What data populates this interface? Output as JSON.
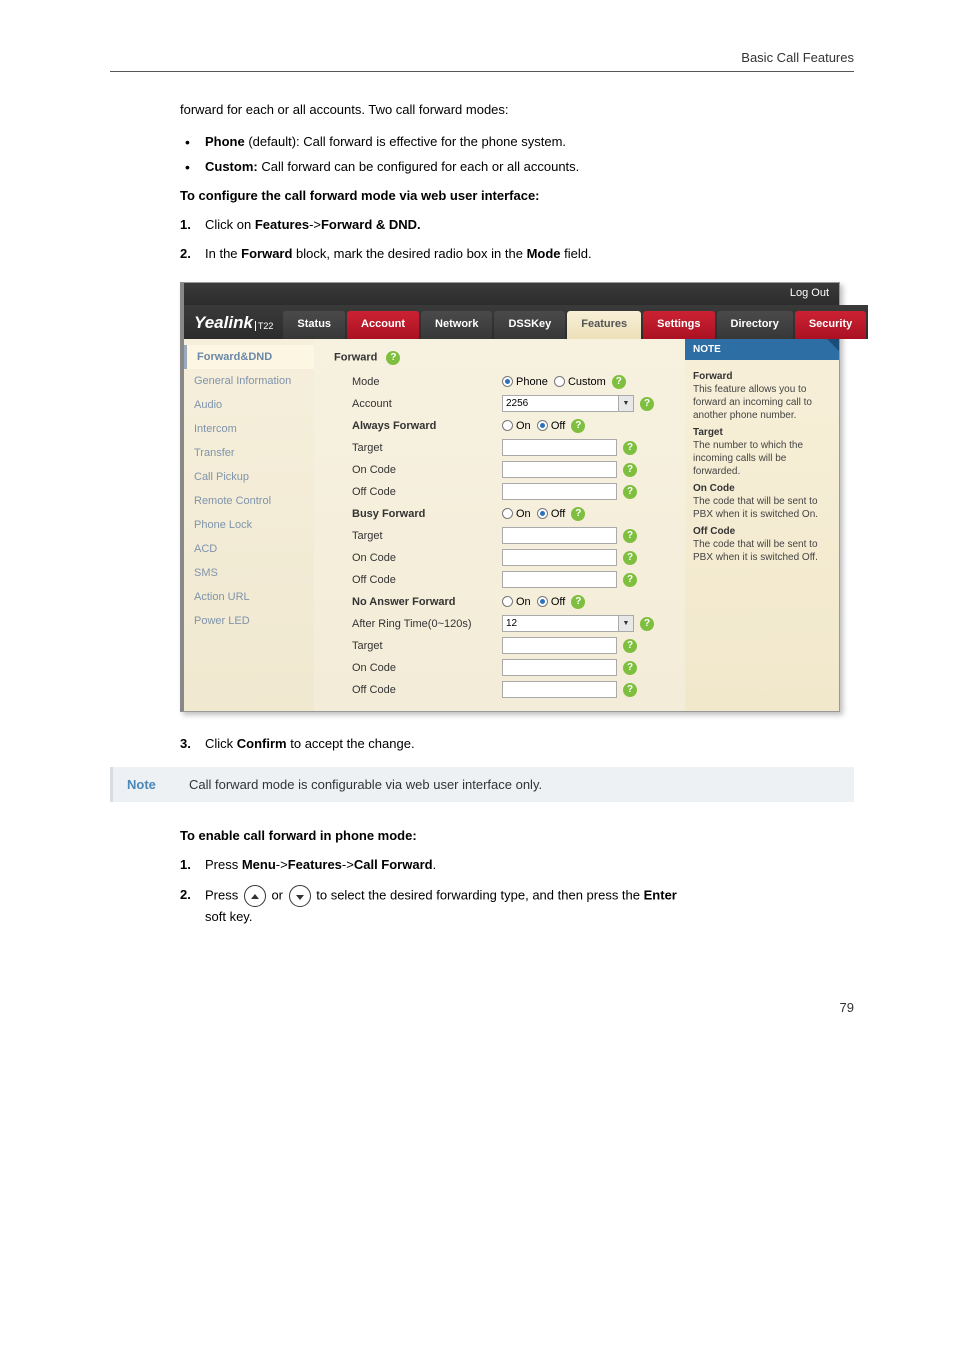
{
  "header": {
    "section": "Basic Call Features"
  },
  "intro": "forward for each or all accounts. Two call forward modes:",
  "bullets": {
    "b1_bold": "Phone",
    "b1_rest": " (default): Call forward is effective for the phone system.",
    "b2_bold": "Custom:",
    "b2_rest": " Call forward can be configured for each or all accounts."
  },
  "subhead1": "To configure the call forward mode via web user interface:",
  "steps1": {
    "s1_pre": "Click on ",
    "s1_b1": "Features",
    "s1_mid": "->",
    "s1_b2": "Forward & DND.",
    "s2_pre": "In the ",
    "s2_b1": "Forward",
    "s2_mid": " block, mark the desired radio box in the ",
    "s2_b2": "Mode",
    "s2_end": " field."
  },
  "screenshot": {
    "logout": "Log Out",
    "brand": "Yealink",
    "brand_sub": "T22",
    "tabs": [
      "Status",
      "Account",
      "Network",
      "DSSKey",
      "Features",
      "Settings",
      "Directory",
      "Security"
    ],
    "sidebar": [
      "Forward&DND",
      "General Information",
      "Audio",
      "Intercom",
      "Transfer",
      "Call Pickup",
      "Remote Control",
      "Phone Lock",
      "ACD",
      "SMS",
      "Action URL",
      "Power LED"
    ],
    "panel_title": "Forward",
    "rows": {
      "mode": "Mode",
      "mode_opt1": "Phone",
      "mode_opt2": "Custom",
      "account": "Account",
      "account_val": "2256",
      "always": "Always Forward",
      "on": "On",
      "off": "Off",
      "target": "Target",
      "oncode": "On Code",
      "offcode": "Off Code",
      "busy": "Busy Forward",
      "noanswer": "No Answer Forward",
      "afterring": "After Ring Time(0~120s)",
      "afterring_val": "12"
    },
    "note": {
      "hdr": "NOTE",
      "t1": "Forward",
      "d1": "This feature allows you to forward an incoming call to another phone number.",
      "t2": "Target",
      "d2": "The number to which the incoming calls will be forwarded.",
      "t3": "On Code",
      "d3": "The code that will be sent to PBX when it is switched On.",
      "t4": "Off Code",
      "d4": "The code that will be sent to PBX when it is switched Off."
    }
  },
  "steps2": {
    "s3_pre": "Click ",
    "s3_b": "Confirm",
    "s3_end": " to accept the change."
  },
  "notebar": {
    "label": "Note",
    "text": "Call forward mode is configurable via web user interface only."
  },
  "subhead2": "To enable call forward in phone mode:",
  "steps3": {
    "s1_pre": "Press ",
    "s1_b1": "Menu",
    "s1_m1": "->",
    "s1_b2": "Features",
    "s1_m2": "->",
    "s1_b3": "Call Forward",
    "s1_end": ".",
    "s2_pre": "Press ",
    "s2_mid": " or ",
    "s2_post": " to select the desired forwarding type, and then press the ",
    "s2_b": "Enter",
    "s2_end": " soft key."
  },
  "page_num": "79"
}
